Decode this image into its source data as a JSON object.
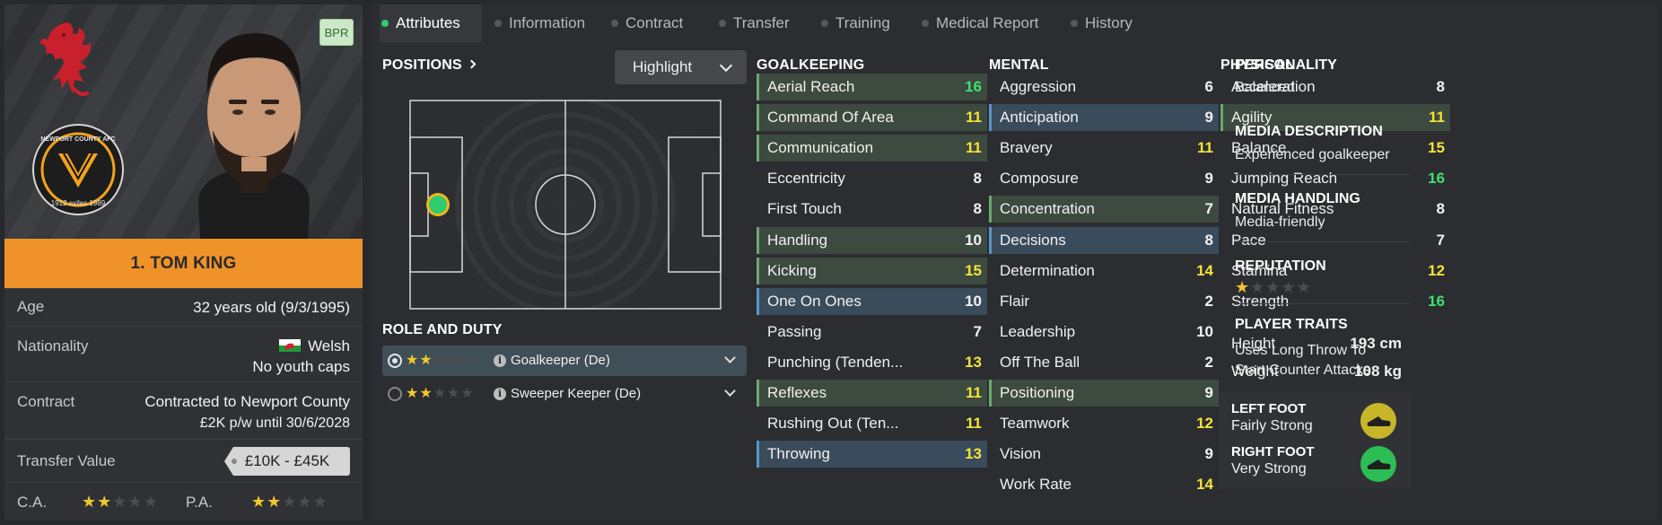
{
  "player": {
    "name": "1. TOM KING",
    "badge": "BPR",
    "age_label": "Age",
    "age_value": "32 years old (9/3/1995)",
    "nationality_label": "Nationality",
    "nationality_value": "Welsh",
    "caps": "No youth caps",
    "contract_label": "Contract",
    "contract_value": "Contracted to Newport County",
    "contract_terms": "£2K p/w until 30/6/2028",
    "transfer_label": "Transfer Value",
    "transfer_value": "£10K - £45K",
    "ca_label": "C.A.",
    "pa_label": "P.A.",
    "ca_stars": 2,
    "pa_stars": 2,
    "crest_text": "NEWPORT COUNTY AFC",
    "crest_years": "1912 exiles 1989"
  },
  "tabs": [
    "Attributes",
    "Information",
    "Contract",
    "Transfer",
    "Training",
    "Medical Report",
    "History"
  ],
  "positions": {
    "title": "POSITIONS",
    "highlight_label": "Highlight",
    "role_title": "ROLE AND DUTY",
    "roles": [
      {
        "name": "Goalkeeper (De)",
        "stars": 2,
        "selected": true
      },
      {
        "name": "Sweeper Keeper (De)",
        "stars": 2,
        "selected": false
      }
    ]
  },
  "goalkeeping": {
    "title": "GOALKEEPING",
    "items": [
      {
        "name": "Aerial Reach",
        "value": "16",
        "hl": "green"
      },
      {
        "name": "Command Of Area",
        "value": "11",
        "hl": "green"
      },
      {
        "name": "Communication",
        "value": "11",
        "hl": "green"
      },
      {
        "name": "Eccentricity",
        "value": "8",
        "hl": ""
      },
      {
        "name": "First Touch",
        "value": "8",
        "hl": ""
      },
      {
        "name": "Handling",
        "value": "10",
        "hl": "green"
      },
      {
        "name": "Kicking",
        "value": "15",
        "hl": "green"
      },
      {
        "name": "One On Ones",
        "value": "10",
        "hl": "blue"
      },
      {
        "name": "Passing",
        "value": "7",
        "hl": ""
      },
      {
        "name": "Punching (Tenden...",
        "value": "13",
        "hl": ""
      },
      {
        "name": "Reflexes",
        "value": "11",
        "hl": "green"
      },
      {
        "name": "Rushing Out (Ten...",
        "value": "11",
        "hl": ""
      },
      {
        "name": "Throwing",
        "value": "13",
        "hl": "blue"
      }
    ]
  },
  "mental": {
    "title": "MENTAL",
    "items": [
      {
        "name": "Aggression",
        "value": "6",
        "hl": ""
      },
      {
        "name": "Anticipation",
        "value": "9",
        "hl": "blue"
      },
      {
        "name": "Bravery",
        "value": "11",
        "hl": ""
      },
      {
        "name": "Composure",
        "value": "9",
        "hl": ""
      },
      {
        "name": "Concentration",
        "value": "7",
        "hl": "green"
      },
      {
        "name": "Decisions",
        "value": "8",
        "hl": "blue"
      },
      {
        "name": "Determination",
        "value": "14",
        "hl": ""
      },
      {
        "name": "Flair",
        "value": "2",
        "hl": ""
      },
      {
        "name": "Leadership",
        "value": "10",
        "hl": ""
      },
      {
        "name": "Off The Ball",
        "value": "2",
        "hl": ""
      },
      {
        "name": "Positioning",
        "value": "9",
        "hl": "green"
      },
      {
        "name": "Teamwork",
        "value": "12",
        "hl": ""
      },
      {
        "name": "Vision",
        "value": "9",
        "hl": ""
      },
      {
        "name": "Work Rate",
        "value": "14",
        "hl": ""
      }
    ]
  },
  "physical": {
    "title": "PHYSICAL",
    "items": [
      {
        "name": "Acceleration",
        "value": "8",
        "hl": ""
      },
      {
        "name": "Agility",
        "value": "11",
        "hl": "green"
      },
      {
        "name": "Balance",
        "value": "15",
        "hl": ""
      },
      {
        "name": "Jumping Reach",
        "value": "16",
        "hl": ""
      },
      {
        "name": "Natural Fitness",
        "value": "8",
        "hl": ""
      },
      {
        "name": "Pace",
        "value": "7",
        "hl": ""
      },
      {
        "name": "Stamina",
        "value": "12",
        "hl": ""
      },
      {
        "name": "Strength",
        "value": "16",
        "hl": ""
      }
    ],
    "height_label": "Height",
    "height_value": "193 cm",
    "weight_label": "Weight",
    "weight_value": "108 kg",
    "left_foot_label": "LEFT FOOT",
    "left_foot_value": "Fairly Strong",
    "right_foot_label": "RIGHT FOOT",
    "right_foot_value": "Very Strong",
    "colors": {
      "left_foot": "#c7b62a",
      "right_foot": "#2dbd55"
    }
  },
  "personality": {
    "personality_label": "PERSONALITY",
    "personality_value": "Balanced",
    "media_desc_label": "MEDIA DESCRIPTION",
    "media_desc_value": "Experienced goalkeeper",
    "media_handling_label": "MEDIA HANDLING",
    "media_handling_value": "Media-friendly",
    "reputation_label": "REPUTATION",
    "reputation_stars": 1,
    "traits_label": "PLAYER TRAITS",
    "traits_line1": "Uses Long Throw To",
    "traits_line2": "Start Counter Attacks"
  },
  "icons": [
    "wales-dragon-icon",
    "club-crest-icon",
    "wales-flag-icon",
    "chevron-down-icon",
    "info-icon",
    "boot-icon",
    "star-icon"
  ]
}
